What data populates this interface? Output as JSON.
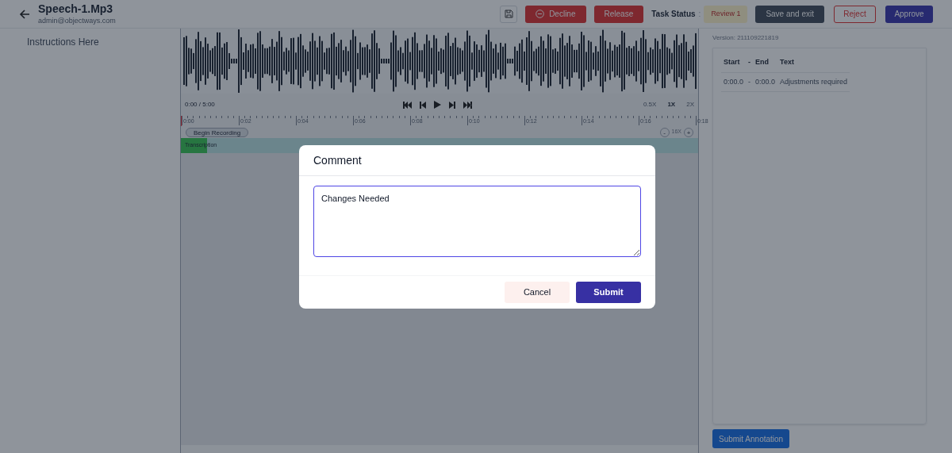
{
  "header": {
    "title": "Speech-1.Mp3",
    "subtitle": "admin@objectways.com",
    "actions": [
      {
        "kind": "icon"
      },
      {
        "kind": "danger",
        "label": "Decline",
        "icon": true
      },
      {
        "kind": "danger",
        "label": "Release"
      },
      {
        "kind": "status",
        "label": "Task Status",
        "separator": ":",
        "badge": "Review 1"
      },
      {
        "kind": "dark",
        "label": "Save and exit"
      },
      {
        "kind": "outline",
        "label": "Reject"
      },
      {
        "kind": "primary",
        "label": "Approve"
      }
    ]
  },
  "instructions": "Instructions Here",
  "player": {
    "time": "0:00 / 5:00",
    "speeds": [
      {
        "label": "0.5X",
        "selected": false
      },
      {
        "label": "1X",
        "selected": true
      },
      {
        "label": "2X",
        "selected": false
      }
    ],
    "ticks": [
      "0:00",
      "0:02",
      "0:04",
      "0:06",
      "0:08",
      "0:10",
      "0:12",
      "0:14",
      "0:16",
      "0:18"
    ],
    "record_button": "Begin Recording",
    "zoom_out": "-",
    "zoom_level": "16X",
    "zoom_in": "+",
    "track": {
      "label": "Transcription",
      "level": 0.05
    }
  },
  "side_panel": {
    "version": "Version: 211109221819",
    "columns": [
      "Start",
      "-",
      "End",
      "Text"
    ],
    "rows": [
      [
        "0:00.0",
        "-",
        "0:00.0",
        "Adjustments required"
      ]
    ],
    "submit": "Submit Annotation"
  },
  "modal": {
    "title": "Comment",
    "value": "Changes Needed",
    "cancel": "Cancel",
    "submit": "Submit"
  }
}
